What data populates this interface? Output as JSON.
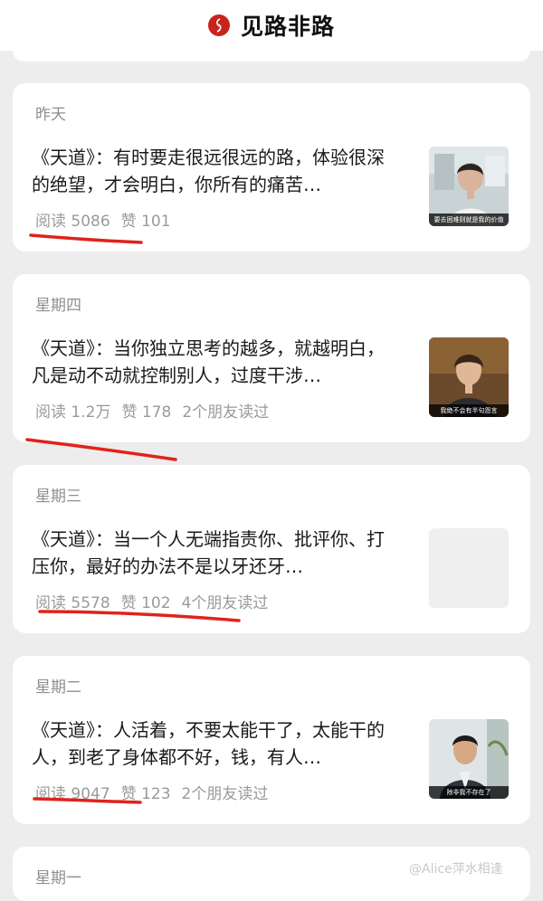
{
  "header": {
    "title": "见路非路",
    "logo_icon": "red-circle-logo-icon",
    "accent": "#c8241c"
  },
  "articles": [
    {
      "day": "昨天",
      "title": "《天道》：有时要走很远很远的路，体验很深的绝望，才会明白，你所有的痛苦…",
      "reads": "阅读 5086",
      "likes": "赞 101",
      "friends": "",
      "thumb_caption": "要去困难则就是我的价值"
    },
    {
      "day": "星期四",
      "title": "《天道》：当你独立思考的越多，就越明白，凡是动不动就控制别人，过度干涉…",
      "reads": "阅读 1.2万",
      "likes": "赞 178",
      "friends": "2个朋友读过",
      "thumb_caption": "我绝不会有半句怨言"
    },
    {
      "day": "星期三",
      "title": "《天道》：当一个人无端指责你、批评你、打压你，最好的办法不是以牙还牙…",
      "reads": "阅读 5578",
      "likes": "赞 102",
      "friends": "4个朋友读过",
      "thumb_caption": ""
    },
    {
      "day": "星期二",
      "title": "《天道》：人活着，不要太能干了，太能干的人，到老了身体都不好，钱，有人…",
      "reads": "阅读 9047",
      "likes": "赞 123",
      "friends": "2个朋友读过",
      "thumb_caption": "除非我不存在了"
    },
    {
      "day": "星期一"
    }
  ],
  "watermark": "@Alice萍水相逢",
  "annotation_color": "#e0231b"
}
